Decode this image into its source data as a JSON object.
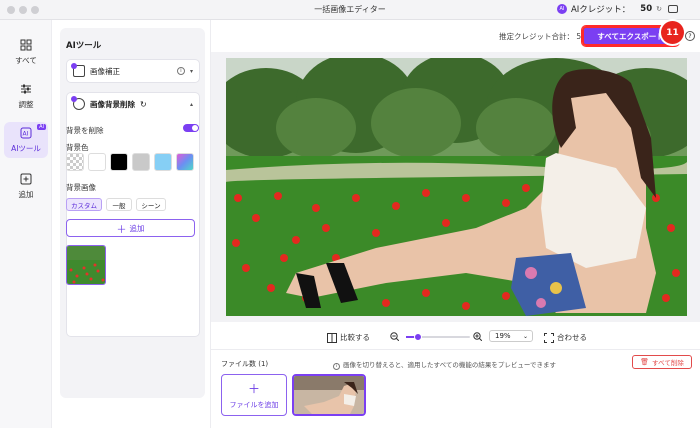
{
  "window": {
    "title": "一括画像エディター"
  },
  "credits": {
    "label": "AIクレジット：",
    "value": "50",
    "ai_icon": "ai-credit-icon",
    "cart_icon": "cart-icon"
  },
  "rail": {
    "items": [
      {
        "label": "すべて",
        "icon": "grid-icon"
      },
      {
        "label": "調整",
        "icon": "sliders-icon"
      },
      {
        "label": "AIツール",
        "icon": "ai-tools-icon",
        "badge": "AI",
        "active": true
      },
      {
        "label": "追加",
        "icon": "plus-square-icon"
      }
    ]
  },
  "panel": {
    "title": "AIツール",
    "enhance": {
      "label": "画像補正",
      "info": "i"
    },
    "bg_remove": {
      "label": "画像背景削除",
      "remove_label": "背景を削除",
      "remove_on": true,
      "color_label": "背景色",
      "image_label": "背景画像",
      "tabs": [
        "カスタム",
        "一般",
        "シーン"
      ],
      "active_tab": "カスタム",
      "add_label": "追加"
    }
  },
  "toolbar": {
    "estimate": "推定クレジット合計：",
    "estimate_value": "5",
    "export_label": "すべてエクスポート",
    "step_number": "11",
    "help": "?"
  },
  "zoombar": {
    "compare_label": "比較する",
    "zoom_value": "19%",
    "zoom_level": 0.19,
    "fit_label": "合わせる"
  },
  "files": {
    "count_label": "ファイル数 (1)",
    "hint": "画像を切り替えると、適用したすべての機能の結果をプレビューできます",
    "delete_label": "すべて削除",
    "add_label": "ファイルを追加"
  },
  "colors": {
    "accent": "#7b3ff2",
    "danger": "#e24b4b",
    "badge": "#e8241e"
  }
}
